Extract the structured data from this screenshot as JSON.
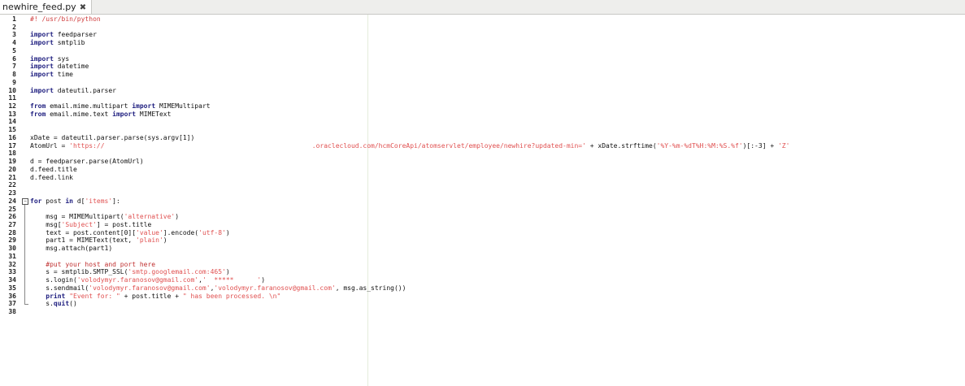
{
  "tab": {
    "filename": "newhire_feed.py",
    "close_glyph": "✖"
  },
  "editor": {
    "lines": [
      {
        "n": "1",
        "s": [
          {
            "c": "sh",
            "t": "#! /usr/bin/python"
          }
        ]
      },
      {
        "n": "2",
        "s": []
      },
      {
        "n": "3",
        "s": [
          {
            "c": "kw",
            "t": "import"
          },
          {
            "c": "",
            "t": " feedparser"
          }
        ]
      },
      {
        "n": "4",
        "s": [
          {
            "c": "kw",
            "t": "import"
          },
          {
            "c": "",
            "t": " smtplib"
          }
        ]
      },
      {
        "n": "5",
        "s": []
      },
      {
        "n": "6",
        "s": [
          {
            "c": "kw",
            "t": "import"
          },
          {
            "c": "",
            "t": " sys"
          }
        ]
      },
      {
        "n": "7",
        "s": [
          {
            "c": "kw",
            "t": "import"
          },
          {
            "c": "",
            "t": " datetime"
          }
        ]
      },
      {
        "n": "8",
        "s": [
          {
            "c": "kw",
            "t": "import"
          },
          {
            "c": "",
            "t": " time"
          }
        ]
      },
      {
        "n": "9",
        "s": []
      },
      {
        "n": "10",
        "s": [
          {
            "c": "kw",
            "t": "import"
          },
          {
            "c": "",
            "t": " dateutil.parser"
          }
        ]
      },
      {
        "n": "11",
        "s": []
      },
      {
        "n": "12",
        "s": [
          {
            "c": "kw",
            "t": "from"
          },
          {
            "c": "",
            "t": " email.mime.multipart "
          },
          {
            "c": "kw",
            "t": "import"
          },
          {
            "c": "",
            "t": " MIMEMultipart"
          }
        ]
      },
      {
        "n": "13",
        "s": [
          {
            "c": "kw",
            "t": "from"
          },
          {
            "c": "",
            "t": " email.mime.text "
          },
          {
            "c": "kw",
            "t": "import"
          },
          {
            "c": "",
            "t": " MIMEText"
          }
        ]
      },
      {
        "n": "14",
        "s": []
      },
      {
        "n": "15",
        "s": []
      },
      {
        "n": "16",
        "s": [
          {
            "c": "",
            "t": "xDate = dateutil.parser.parse(sys.argv[1])"
          }
        ]
      },
      {
        "n": "17",
        "s": [
          {
            "c": "",
            "t": "AtomUrl = "
          },
          {
            "c": "st",
            "t": "'https://                                                     .oraclecloud.com/hcmCoreApi/atomservlet/employee/newhire?updated-min='"
          },
          {
            "c": "",
            "t": " + xDate.strftime("
          },
          {
            "c": "st",
            "t": "'%Y-%m-%dT%H:%M:%S.%f'"
          },
          {
            "c": "",
            "t": ")[:-3] + "
          },
          {
            "c": "st",
            "t": "'Z'"
          }
        ]
      },
      {
        "n": "18",
        "s": []
      },
      {
        "n": "19",
        "s": [
          {
            "c": "",
            "t": "d = feedparser.parse(AtomUrl)"
          }
        ]
      },
      {
        "n": "20",
        "s": [
          {
            "c": "",
            "t": "d.feed.title"
          }
        ]
      },
      {
        "n": "21",
        "s": [
          {
            "c": "",
            "t": "d.feed.link"
          }
        ]
      },
      {
        "n": "22",
        "s": []
      },
      {
        "n": "23",
        "s": []
      },
      {
        "n": "24",
        "s": [
          {
            "c": "kw",
            "t": "for"
          },
          {
            "c": "",
            "t": " post "
          },
          {
            "c": "kw",
            "t": "in"
          },
          {
            "c": "",
            "t": " d["
          },
          {
            "c": "st",
            "t": "'items'"
          },
          {
            "c": "",
            "t": "]:"
          }
        ]
      },
      {
        "n": "25",
        "s": []
      },
      {
        "n": "26",
        "s": [
          {
            "c": "",
            "t": "    msg = MIMEMultipart("
          },
          {
            "c": "st",
            "t": "'alternative'"
          },
          {
            "c": "",
            "t": ")"
          }
        ]
      },
      {
        "n": "27",
        "s": [
          {
            "c": "",
            "t": "    msg["
          },
          {
            "c": "st",
            "t": "'Subject'"
          },
          {
            "c": "",
            "t": "] = post.title"
          }
        ]
      },
      {
        "n": "28",
        "s": [
          {
            "c": "",
            "t": "    text = post.content[0]["
          },
          {
            "c": "st",
            "t": "'value'"
          },
          {
            "c": "",
            "t": "].encode("
          },
          {
            "c": "st",
            "t": "'utf-8'"
          },
          {
            "c": "",
            "t": ")"
          }
        ]
      },
      {
        "n": "29",
        "s": [
          {
            "c": "",
            "t": "    part1 = MIMEText(text, "
          },
          {
            "c": "st",
            "t": "'plain'"
          },
          {
            "c": "",
            "t": ")"
          }
        ]
      },
      {
        "n": "30",
        "s": [
          {
            "c": "",
            "t": "    msg.attach(part1)"
          }
        ]
      },
      {
        "n": "31",
        "s": []
      },
      {
        "n": "32",
        "s": [
          {
            "c": "cm",
            "t": "    #put your host and port here"
          }
        ]
      },
      {
        "n": "33",
        "s": [
          {
            "c": "",
            "t": "    s = smtplib.SMTP_SSL("
          },
          {
            "c": "st",
            "t": "'smtp.googlemail.com:465'"
          },
          {
            "c": "",
            "t": ")"
          }
        ]
      },
      {
        "n": "34",
        "s": [
          {
            "c": "",
            "t": "    s.login("
          },
          {
            "c": "st",
            "t": "'volodymyr.faranosov@gmail.com'"
          },
          {
            "c": "",
            "t": ","
          },
          {
            "c": "st",
            "t": "'  *****      '"
          },
          {
            "c": "",
            "t": ")"
          }
        ]
      },
      {
        "n": "35",
        "s": [
          {
            "c": "",
            "t": "    s.sendmail("
          },
          {
            "c": "st",
            "t": "'volodymyr.faranosov@gmail.com'"
          },
          {
            "c": "",
            "t": ","
          },
          {
            "c": "st",
            "t": "'volodymyr.faranosov@gmail.com'"
          },
          {
            "c": "",
            "t": ", msg.as_string())"
          }
        ]
      },
      {
        "n": "36",
        "s": [
          {
            "c": "",
            "t": "    "
          },
          {
            "c": "kw",
            "t": "print"
          },
          {
            "c": "",
            "t": " "
          },
          {
            "c": "st",
            "t": "\"Event for: \""
          },
          {
            "c": "",
            "t": " + post.title + "
          },
          {
            "c": "st",
            "t": "\" has been processed. \\n\""
          }
        ]
      },
      {
        "n": "37",
        "s": [
          {
            "c": "",
            "t": "    s."
          },
          {
            "c": "kw",
            "t": "quit"
          },
          {
            "c": "",
            "t": "()"
          }
        ]
      },
      {
        "n": "38",
        "s": []
      }
    ]
  }
}
